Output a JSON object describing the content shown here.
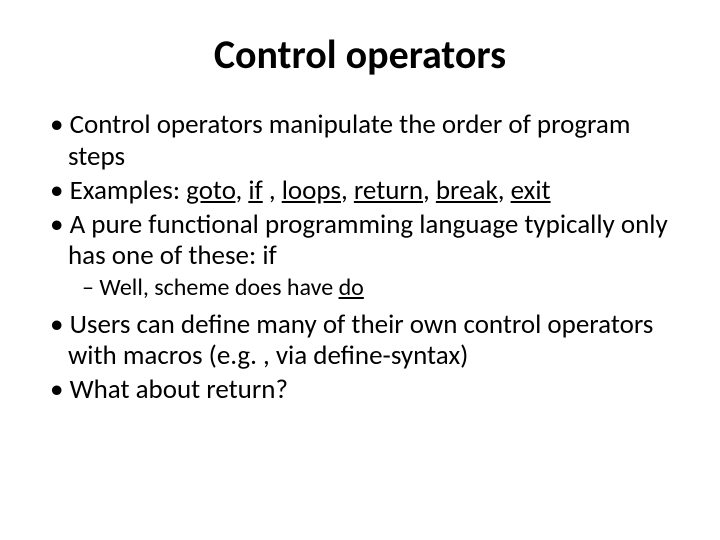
{
  "title": "Control operators",
  "bullets": {
    "b1": "Control operators manipulate the order of program steps",
    "b2_pre": "Examples: ",
    "b2_goto": "goto",
    "b2_if": "if",
    "b2_loops": "loops",
    "b2_return": "return",
    "b2_break": "break",
    "b2_exit": "exit",
    "b3": "A pure functional programming language typically only has one of these: if",
    "b3_sub_pre": "Well, scheme does have ",
    "b3_sub_do": "do",
    "b4": "Users can define many of their own control operators with macros (e.g. , via define-syntax)",
    "b5": "What about return?"
  }
}
